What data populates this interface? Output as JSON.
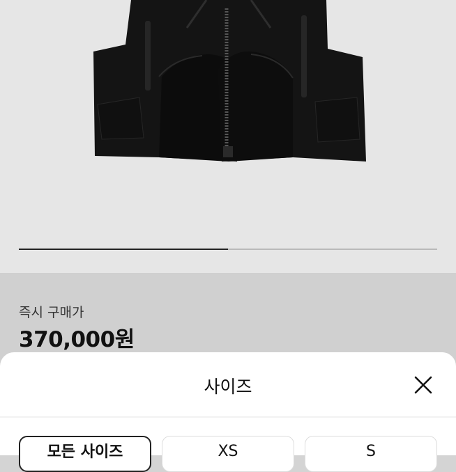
{
  "product": {
    "image_alt_icon": "black-tactical-vest",
    "image_progress": 0.5
  },
  "pricing": {
    "label": "즉시 구매가",
    "value": "370,000원"
  },
  "size_sheet": {
    "title": "사이즈",
    "close_icon": "close-icon",
    "options": [
      {
        "label": "모든 사이즈",
        "selected": true
      },
      {
        "label": "XS",
        "selected": false
      },
      {
        "label": "S",
        "selected": false
      }
    ]
  },
  "colors": {
    "accent": "#222222",
    "sheet_bg": "#ffffff",
    "hero_bg": "#e6e6e6"
  }
}
